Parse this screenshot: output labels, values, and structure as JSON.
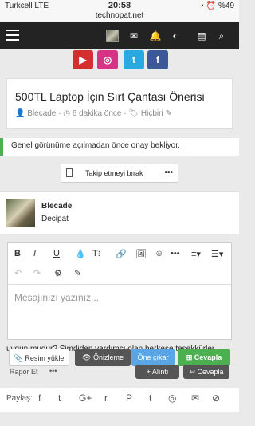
{
  "status": {
    "carrier": "Turkcell  LTE",
    "time": "20:58",
    "right": "◔ ⏰ %49",
    "url": "technopat.net"
  },
  "social": [
    "▶",
    "◎",
    "t",
    "f"
  ],
  "thread": {
    "title": "500TL Laptop İçin Sırt Çantası Önerisi",
    "author": "Blecade",
    "time": "6 dakika önce",
    "tag": "Hiçbiri"
  },
  "notice": "Genel görünüme açılmadan önce onay bekliyor.",
  "watch": {
    "label": "Takip etmeyi bırak",
    "more": "•••"
  },
  "post": {
    "name": "Blecade",
    "body": "Decipat"
  },
  "editor": {
    "placeholder": "Mesajınızı yazınız...",
    "tb1": [
      "B",
      "I",
      "U",
      "💧",
      "T⁞",
      "🔗",
      "🖼",
      "☺",
      "•••",
      "≡▾",
      "☰▾"
    ],
    "tb2": [
      "↶",
      "↷",
      "⚙",
      "✎"
    ]
  },
  "underlay": {
    "text": "uygun mudur? Şimdiden yardımcı olan herkese teşekkürler.",
    "report": "Rapor Et",
    "more": "•••"
  },
  "actions": {
    "upload": "Resim yükle",
    "preview": "Önizleme",
    "promote": "Öne çıkar",
    "reply": "Cevapla",
    "quote": "+ Alıntı",
    "reply2": "Cevapla"
  },
  "share": {
    "label": "Paylaş:",
    "icons": [
      "f",
      "t",
      "G+",
      "r",
      "P",
      "t",
      "◎",
      "✉",
      "⊘"
    ]
  }
}
